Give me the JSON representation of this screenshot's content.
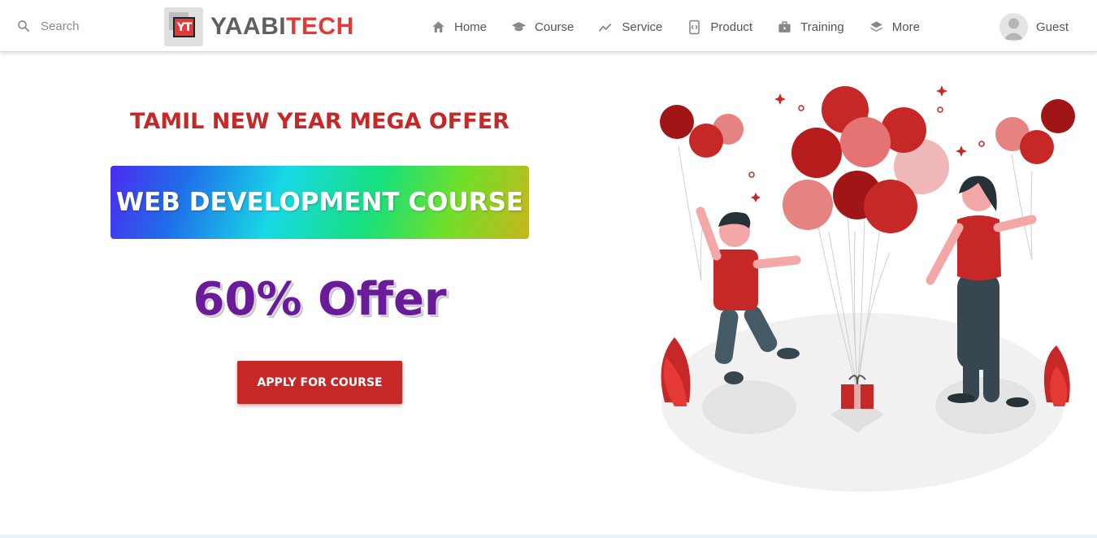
{
  "search": {
    "placeholder": "Search",
    "icon": "search-icon"
  },
  "brand": {
    "logo_text": "YT",
    "name_part1": "YAABI",
    "name_part2": "TECH",
    "accent": "#e53935",
    "gray": "#606060"
  },
  "nav": {
    "items": [
      {
        "label": "Home",
        "icon": "home-icon"
      },
      {
        "label": "Course",
        "icon": "graduation-cap-icon"
      },
      {
        "label": "Service",
        "icon": "trending-icon"
      },
      {
        "label": "Product",
        "icon": "code-icon"
      },
      {
        "label": "Training",
        "icon": "briefcase-icon"
      },
      {
        "label": "More",
        "icon": "layers-icon"
      }
    ]
  },
  "user": {
    "label": "Guest",
    "icon": "avatar-icon"
  },
  "hero": {
    "title": "TAMIL NEW YEAR MEGA OFFER",
    "course": "WEB DEVELOPMENT COURSE",
    "offer": "60% Offer",
    "button": "APPLY FOR COURSE",
    "colors": {
      "title": "#c62828",
      "offer": "#6a1b9a",
      "button": "#c62828"
    }
  }
}
